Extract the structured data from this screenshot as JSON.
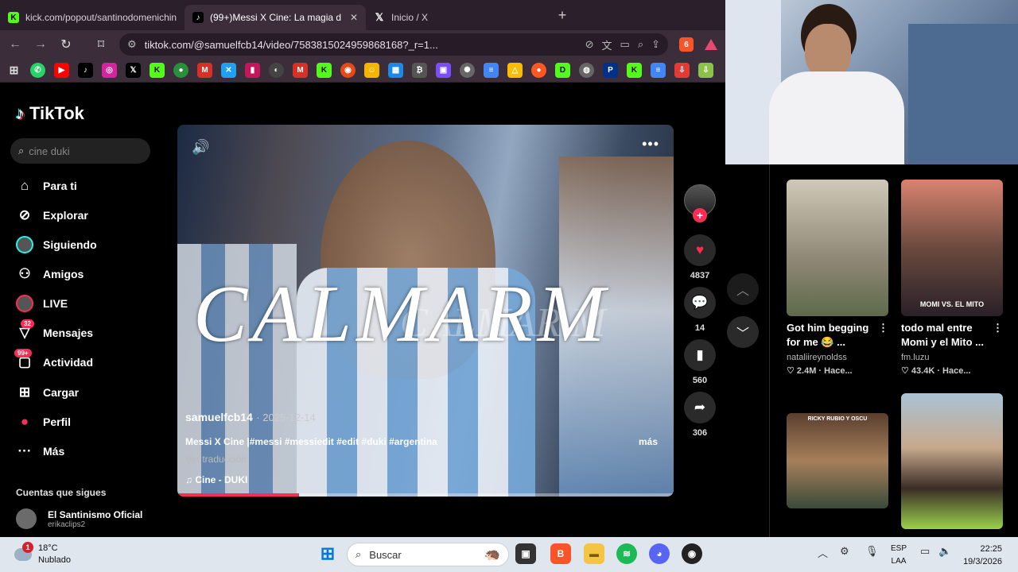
{
  "browser": {
    "tabs": [
      {
        "label": "kick.com/popout/santinodomenichin",
        "icon": "kick-icon",
        "color": "#53fc18"
      },
      {
        "label": "(99+)Messi X Cine: La magia d",
        "icon": "tiktok-icon",
        "color": "#000000",
        "active": true
      },
      {
        "label": "Inicio / X",
        "icon": "x-icon",
        "color": "#000000"
      }
    ],
    "new_tab": "+",
    "url": "tiktok.com/@samuelfcb14/video/7583815024959868168?_r=1...",
    "shield_count": "6"
  },
  "tiktok": {
    "logo": "TikTok",
    "search_placeholder": "cine duki",
    "nav": [
      {
        "label": "Para ti",
        "icon": "home-icon"
      },
      {
        "label": "Explorar",
        "icon": "compass-icon"
      },
      {
        "label": "Siguiendo",
        "icon": "following-avatar-icon"
      },
      {
        "label": "Amigos",
        "icon": "friends-icon"
      },
      {
        "label": "LIVE",
        "icon": "live-icon"
      },
      {
        "label": "Mensajes",
        "icon": "messages-icon",
        "badge": "32"
      },
      {
        "label": "Actividad",
        "icon": "activity-icon",
        "badge": "99+"
      },
      {
        "label": "Cargar",
        "icon": "upload-icon"
      },
      {
        "label": "Perfil",
        "icon": "profile-icon"
      },
      {
        "label": "Más",
        "icon": "more-icon"
      }
    ],
    "following_title": "Cuentas que sigues",
    "following": [
      {
        "name": "El Santinismo Oficial",
        "handle": "erikaclips2"
      }
    ]
  },
  "video": {
    "overlay_text": "CALMARM",
    "overlay_text_shadow": "CALMAR M",
    "author": "samuelfcb14",
    "date": "· 2025-12-14",
    "description": "Messi X Cine |#messi #messiedit #edit #duki #argentina",
    "more": "más",
    "translate": "Ver traducción",
    "music": "♫  Cine - DUKI",
    "progress": 0.245,
    "likes": "4837",
    "comments": "14",
    "saves": "560",
    "shares": "306"
  },
  "recommended": [
    {
      "title": "Got him begging for me 😂 ...",
      "author": "nataliireynoldss",
      "stats": "♡ 2.4M · Hace...",
      "color": "#8e8674"
    },
    {
      "title": "todo mal entre Momi y el Mito ...",
      "author": "fm.luzu",
      "stats": "♡ 43.4K · Hace...",
      "color": "#6a4a3e",
      "caption": "MOMI VS. EL MITO"
    },
    {
      "title": "",
      "author": "",
      "stats": "",
      "color": "#7a5a3e",
      "caption": "RICKY RUBIO Y OSCU"
    },
    {
      "title": "",
      "author": "",
      "stats": "",
      "color": "#6f8795"
    }
  ],
  "taskbar": {
    "temperature": "18°C",
    "weather": "Nublado",
    "weather_badge": "1",
    "search": "Buscar",
    "lang_top": "ESP",
    "lang_bottom": "LAA",
    "time": "22:25",
    "date": "19/3/2026"
  }
}
